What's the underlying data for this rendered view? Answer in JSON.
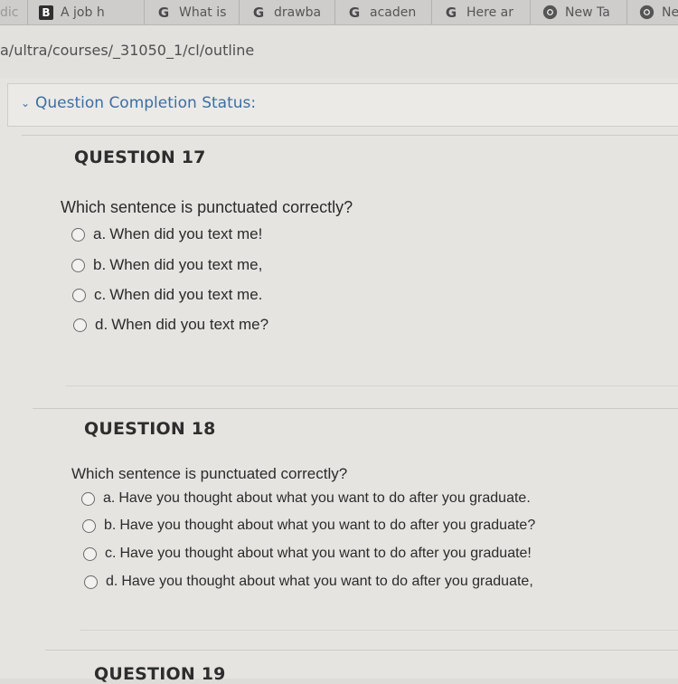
{
  "browser": {
    "tabs": [
      {
        "label": "dic",
        "icon": "partial-tab"
      },
      {
        "label": "A job h",
        "icon": "blackboard-icon"
      },
      {
        "label": "What is",
        "icon": "google-icon"
      },
      {
        "label": "drawba",
        "icon": "google-icon"
      },
      {
        "label": "acaden",
        "icon": "google-icon"
      },
      {
        "label": "Here ar",
        "icon": "google-icon"
      },
      {
        "label": "New Ta",
        "icon": "chrome-icon"
      },
      {
        "label": "New T",
        "icon": "chrome-icon"
      }
    ],
    "url": "a/ultra/courses/_31050_1/cl/outline"
  },
  "status": {
    "label": "Question Completion Status:"
  },
  "questions": [
    {
      "title": "QUESTION 17",
      "text": "Which sentence is punctuated correctly?",
      "options": [
        {
          "letter": "a.",
          "text": "When did you text me!"
        },
        {
          "letter": "b.",
          "text": "When did you text me,"
        },
        {
          "letter": "c.",
          "text": "When did you text me."
        },
        {
          "letter": "d.",
          "text": "When did you text me?"
        }
      ]
    },
    {
      "title": "QUESTION 18",
      "text": "Which sentence is punctuated correctly?",
      "options": [
        {
          "letter": "a.",
          "text": "Have you thought about what you want to do after you graduate."
        },
        {
          "letter": "b.",
          "text": "Have you thought about what you want to do after you graduate?"
        },
        {
          "letter": "c.",
          "text": "Have you thought about what you want to do after you graduate!"
        },
        {
          "letter": "d.",
          "text": "Have you thought about what you want to do after you graduate,"
        }
      ]
    },
    {
      "title": "QUESTION 19"
    }
  ]
}
